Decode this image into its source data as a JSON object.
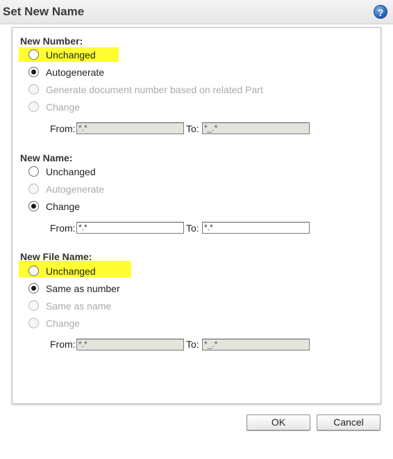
{
  "dialog": {
    "title": "Set New Name",
    "help_icon": "?"
  },
  "new_number": {
    "heading": "New Number:",
    "options": [
      {
        "label": "Unchanged",
        "selected": false,
        "enabled": true,
        "highlighted": true
      },
      {
        "label": "Autogenerate",
        "selected": true,
        "enabled": true
      },
      {
        "label": "Generate document number based on related Part",
        "selected": false,
        "enabled": false
      },
      {
        "label": "Change",
        "selected": false,
        "enabled": false
      }
    ],
    "from_label": "From:",
    "from_value": "*.*",
    "to_label": "To:",
    "to_value": "*_.*"
  },
  "new_name": {
    "heading": "New Name:",
    "options": [
      {
        "label": "Unchanged",
        "selected": false,
        "enabled": true
      },
      {
        "label": "Autogenerate",
        "selected": false,
        "enabled": false
      },
      {
        "label": "Change",
        "selected": true,
        "enabled": true
      }
    ],
    "from_label": "From:",
    "from_value": "*.*",
    "to_label": "To:",
    "to_value": "*.*"
  },
  "new_file_name": {
    "heading": "New File Name:",
    "options": [
      {
        "label": "Unchanged",
        "selected": false,
        "enabled": true,
        "highlighted": true
      },
      {
        "label": "Same as number",
        "selected": true,
        "enabled": true
      },
      {
        "label": "Same as name",
        "selected": false,
        "enabled": false
      },
      {
        "label": "Change",
        "selected": false,
        "enabled": false
      }
    ],
    "from_label": "From:",
    "from_value": "*.*",
    "to_label": "To:",
    "to_value": "*_.*"
  },
  "buttons": {
    "ok": "OK",
    "cancel": "Cancel"
  },
  "colors": {
    "highlight": "#ffff33",
    "disabled_field": "#e4e4dc",
    "help_icon": "#1f5fb3"
  }
}
